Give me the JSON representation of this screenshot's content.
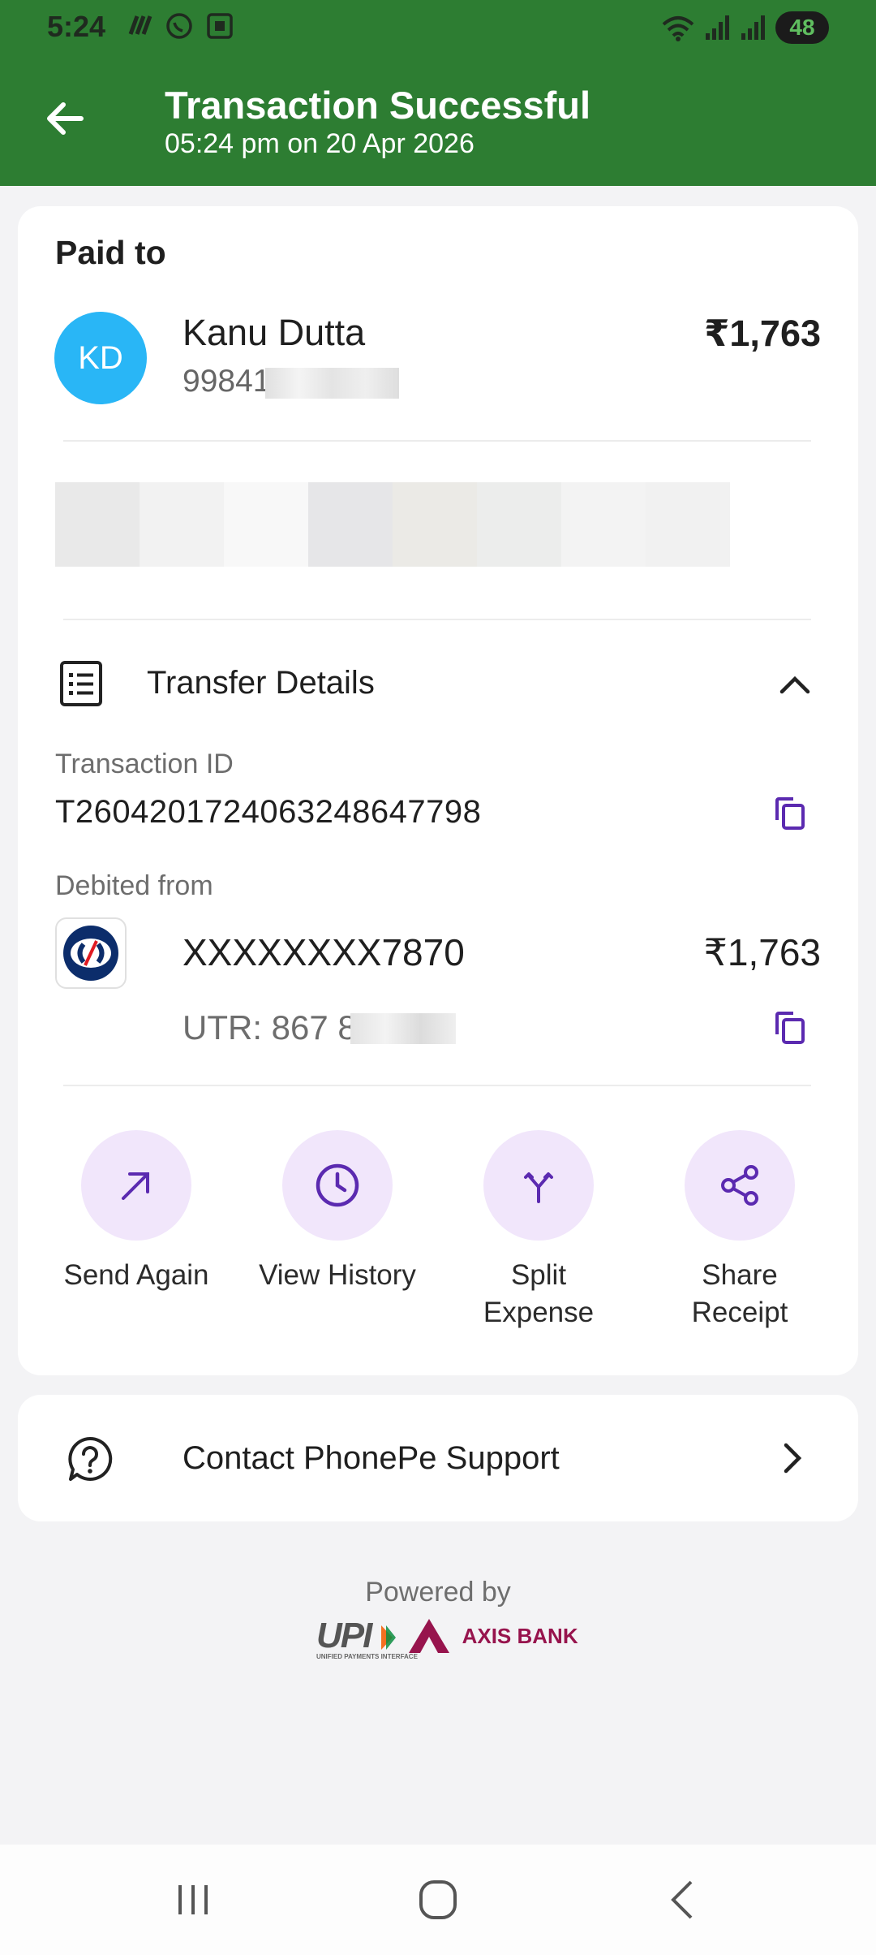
{
  "status_bar": {
    "time": "5:24",
    "battery": "48"
  },
  "header": {
    "title": "Transaction Successful",
    "subtitle": "05:24 pm on 20 Apr 2026",
    "color": "#2d7d32"
  },
  "paid_to": {
    "label": "Paid to",
    "avatar_initials": "KD",
    "name": "Kanu Dutta",
    "vpa": "99841      mbk",
    "amount": "₹1,763"
  },
  "transfer_details": {
    "title": "Transfer Details",
    "transaction_id_label": "Transaction ID",
    "transaction_id": "T2604201724063248647798",
    "debited_from_label": "Debited from",
    "account_number": "XXXXXXXX7870",
    "account_amount": "₹1,763",
    "utr": "UTR: 867         809"
  },
  "actions": [
    {
      "label": "Send Again",
      "icon": "arrow-up-right-icon"
    },
    {
      "label": "View History",
      "icon": "clock-icon"
    },
    {
      "label": "Split Expense",
      "icon": "split-icon"
    },
    {
      "label": "Share Receipt",
      "icon": "share-icon"
    }
  ],
  "support": {
    "label": "Contact PhonePe Support",
    "icon": "help-circle-icon"
  },
  "footer": {
    "powered_by": "Powered by",
    "upi": "UPI",
    "upi_sub": "UNIFIED PAYMENTS INTERFACE",
    "bank": "AXIS BANK"
  },
  "accent_color": "#5b2ab0"
}
